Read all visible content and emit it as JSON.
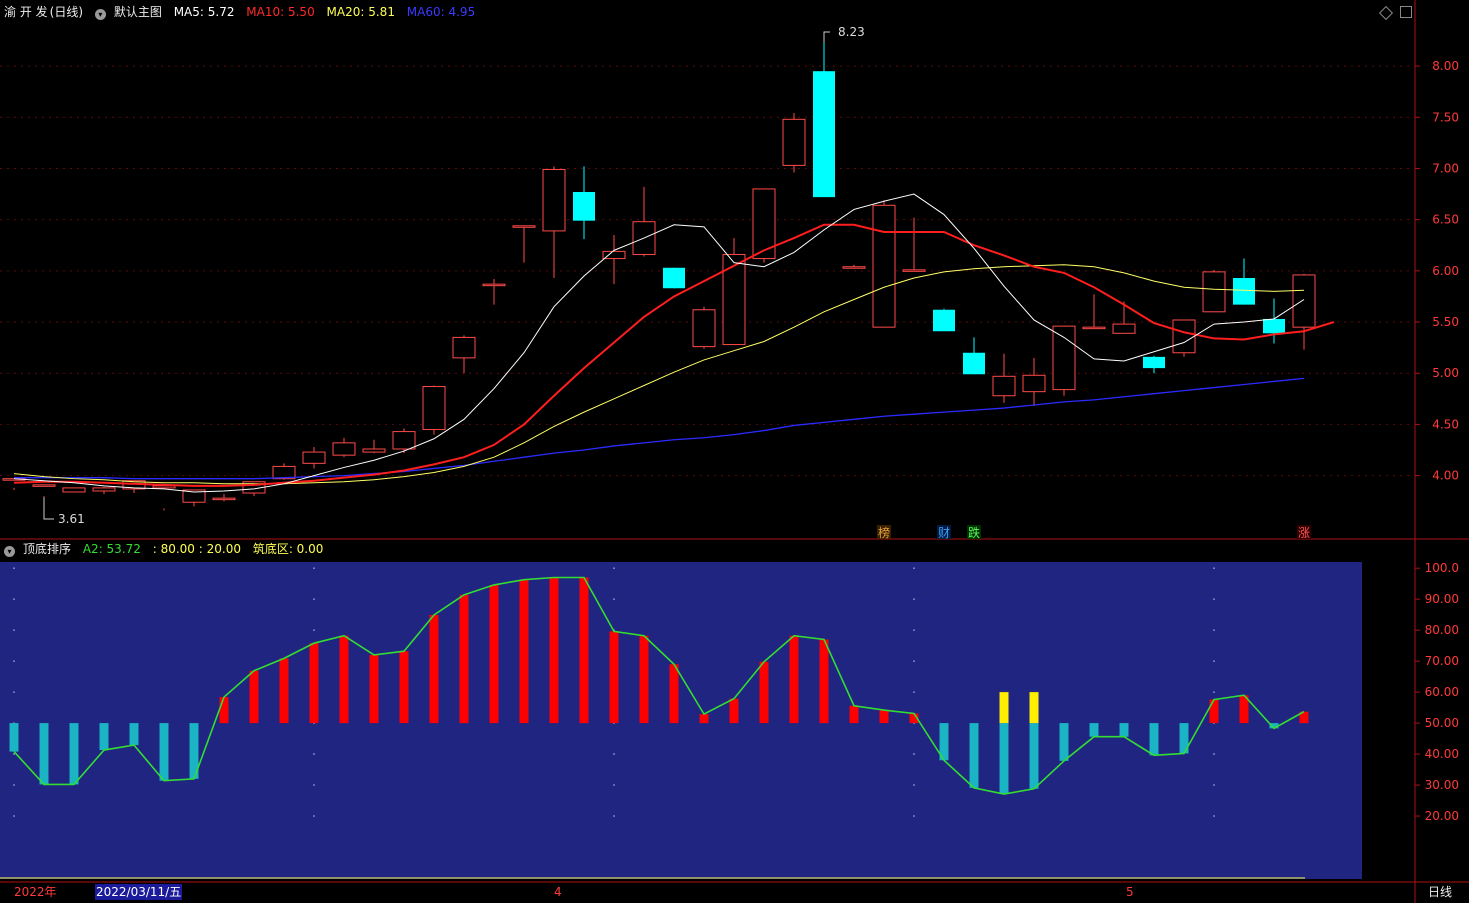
{
  "main_header": {
    "stock": "渝 开 发",
    "period": "(日线)",
    "template": "默认主图",
    "ma5": "MA5: 5.72",
    "ma10": "MA10: 5.50",
    "ma20": "MA20: 5.81",
    "ma60": "MA60: 4.95"
  },
  "sub_header": {
    "indicator": "顶底排序",
    "a2": "A2: 53.72",
    "bounds": ": 80.00 : 20.00",
    "bottom_zone": "筑底区: 0.00"
  },
  "colors": {
    "up": "#ff4a4a",
    "down": "#00ffff",
    "ma5": "#ffffff",
    "ma10": "#ff1e1e",
    "ma20": "#ffff66",
    "ma60": "#2b2bff",
    "panel_bg": "#1f2580",
    "osc_line": "#33dd33",
    "osc_red": "#ff0000",
    "osc_teal": "#1ab4c4",
    "osc_yellow": "#ffee00"
  },
  "chart_data": [
    {
      "type": "candlestick",
      "y_ticks": [
        "8.00",
        "7.50",
        "7.00",
        "6.50",
        "6.00",
        "5.50",
        "5.00",
        "4.50",
        "4.00"
      ],
      "ylim": [
        3.42,
        8.45
      ],
      "annotations": {
        "high": "8.23",
        "low": "3.61"
      },
      "event_markers": [
        "榜",
        "财",
        "跌",
        "涨"
      ],
      "candles": [
        [
          3.96,
          3.97,
          3.88,
          3.86
        ],
        [
          3.9,
          3.91,
          3.8,
          3.79
        ],
        [
          3.84,
          3.88,
          3.88,
          3.84
        ],
        [
          3.85,
          3.88,
          3.89,
          3.82
        ],
        [
          3.87,
          3.95,
          3.95,
          3.83
        ],
        [
          3.88,
          3.9,
          3.68,
          3.66
        ],
        [
          3.74,
          3.86,
          3.86,
          3.7
        ],
        [
          3.77,
          3.78,
          3.82,
          3.75
        ],
        [
          3.83,
          3.94,
          3.94,
          3.8
        ],
        [
          3.97,
          4.09,
          4.12,
          3.96
        ],
        [
          4.12,
          4.23,
          4.28,
          4.07
        ],
        [
          4.2,
          4.32,
          4.37,
          4.18
        ],
        [
          4.23,
          4.26,
          4.35,
          4.22
        ],
        [
          4.26,
          4.43,
          4.46,
          4.22
        ],
        [
          4.45,
          4.87,
          4.88,
          4.4
        ],
        [
          5.15,
          5.35,
          5.37,
          5.0
        ],
        [
          5.87,
          5.87,
          5.92,
          5.67
        ],
        [
          6.44,
          6.44,
          6.44,
          6.08
        ],
        [
          6.39,
          6.99,
          7.02,
          5.93
        ],
        [
          6.77,
          6.49,
          7.02,
          6.31
        ],
        [
          6.12,
          6.19,
          6.35,
          5.87
        ],
        [
          6.16,
          6.48,
          6.82,
          6.14
        ],
        [
          6.03,
          5.83,
          6.03,
          5.83
        ],
        [
          5.26,
          5.62,
          5.65,
          5.24
        ],
        [
          5.28,
          6.16,
          6.32,
          5.3
        ],
        [
          6.12,
          6.8,
          6.8,
          6.08
        ],
        [
          7.03,
          7.48,
          7.54,
          6.96
        ],
        [
          7.95,
          6.72,
          8.23,
          6.72
        ],
        [
          6.04,
          6.04,
          6.06,
          6.04
        ],
        [
          5.45,
          6.64,
          6.69,
          5.45
        ],
        [
          6.01,
          6.01,
          6.52,
          6.01
        ],
        [
          5.62,
          5.41,
          5.63,
          5.41
        ],
        [
          5.2,
          4.99,
          5.35,
          4.99
        ],
        [
          4.78,
          4.97,
          5.19,
          4.71
        ],
        [
          4.82,
          4.98,
          5.15,
          4.68
        ],
        [
          4.84,
          5.46,
          5.46,
          4.78
        ],
        [
          5.45,
          5.45,
          5.77,
          5.45
        ],
        [
          5.39,
          5.48,
          5.7,
          5.39
        ],
        [
          5.16,
          5.05,
          5.17,
          5.0
        ],
        [
          5.2,
          5.52,
          5.52,
          5.16
        ],
        [
          5.6,
          5.99,
          6.01,
          5.6
        ],
        [
          5.93,
          5.67,
          6.12,
          5.67
        ],
        [
          5.53,
          5.39,
          5.73,
          5.29
        ],
        [
          5.45,
          5.96,
          5.97,
          5.23
        ]
      ],
      "ma5": [
        3.97,
        3.95,
        3.93,
        3.9,
        3.88,
        3.87,
        3.84,
        3.85,
        3.87,
        3.92,
        4.0,
        4.08,
        4.15,
        4.24,
        4.36,
        4.55,
        4.85,
        5.2,
        5.65,
        5.95,
        6.2,
        6.32,
        6.45,
        6.43,
        6.08,
        6.04,
        6.18,
        6.4,
        6.6,
        6.68,
        6.75,
        6.55,
        6.22,
        5.85,
        5.52,
        5.35,
        5.14,
        5.12,
        5.21,
        5.3,
        5.48,
        5.5,
        5.53,
        5.72
      ],
      "ma10": [
        3.93,
        3.94,
        3.94,
        3.93,
        3.92,
        3.91,
        3.9,
        3.9,
        3.91,
        3.93,
        3.95,
        3.98,
        4.01,
        4.05,
        4.11,
        4.18,
        4.3,
        4.5,
        4.78,
        5.05,
        5.3,
        5.55,
        5.75,
        5.9,
        6.05,
        6.2,
        6.32,
        6.45,
        6.45,
        6.38,
        6.38,
        6.38,
        6.25,
        6.15,
        6.04,
        5.98,
        5.84,
        5.67,
        5.49,
        5.4,
        5.34,
        5.33,
        5.38,
        5.41,
        5.5
      ],
      "ma20": [
        4.02,
        3.99,
        3.97,
        3.96,
        3.94,
        3.93,
        3.93,
        3.92,
        3.92,
        3.92,
        3.93,
        3.94,
        3.96,
        3.99,
        4.03,
        4.09,
        4.18,
        4.32,
        4.48,
        4.62,
        4.75,
        4.88,
        5.01,
        5.13,
        5.22,
        5.31,
        5.45,
        5.6,
        5.72,
        5.84,
        5.93,
        5.99,
        6.02,
        6.04,
        6.05,
        6.06,
        6.04,
        5.98,
        5.9,
        5.84,
        5.82,
        5.81,
        5.8,
        5.81
      ],
      "ma60": [
        3.98,
        3.98,
        3.98,
        3.98,
        3.97,
        3.97,
        3.97,
        3.97,
        3.97,
        3.98,
        3.99,
        4.0,
        4.02,
        4.04,
        4.07,
        4.1,
        4.14,
        4.18,
        4.22,
        4.25,
        4.29,
        4.32,
        4.35,
        4.37,
        4.4,
        4.44,
        4.49,
        4.52,
        4.55,
        4.58,
        4.6,
        4.62,
        4.64,
        4.66,
        4.69,
        4.72,
        4.74,
        4.77,
        4.8,
        4.83,
        4.86,
        4.89,
        4.92,
        4.95
      ]
    },
    {
      "type": "bar",
      "y_ticks": [
        "100.0",
        "90.00",
        "80.00",
        "70.00",
        "60.00",
        "50.00",
        "40.00",
        "30.00",
        "20.00"
      ],
      "ylim": [
        0,
        102
      ],
      "baseline": 50,
      "values": [
        40.8,
        30.2,
        30.2,
        41.3,
        42.9,
        31.4,
        32.0,
        58.4,
        66.9,
        70.9,
        75.8,
        78.2,
        72.0,
        73.2,
        84.9,
        91.4,
        94.6,
        96.3,
        97.0,
        97.0,
        79.6,
        78.2,
        69.0,
        52.9,
        57.9,
        69.8,
        78.2,
        77.0,
        55.6,
        54.2,
        53.1,
        38.0,
        29.1,
        27.1,
        28.8,
        37.8,
        45.6,
        45.6,
        39.6,
        40.2,
        57.6,
        59.0,
        48.3,
        53.7
      ],
      "yellow_top": [
        0,
        0,
        0,
        0,
        0,
        0,
        0,
        0,
        0,
        0,
        0,
        0,
        0,
        0,
        0,
        0,
        0,
        0,
        0,
        0,
        0,
        0,
        0,
        0,
        0,
        0,
        0,
        0,
        0,
        0,
        0,
        0,
        0,
        1,
        1,
        0,
        0,
        0,
        0,
        0,
        0,
        0,
        0,
        0
      ]
    }
  ],
  "axis": {
    "year": "2022年",
    "cursor_date": "2022/03/11/五",
    "month_4": "4",
    "month_5": "5",
    "period_label": "日线"
  }
}
